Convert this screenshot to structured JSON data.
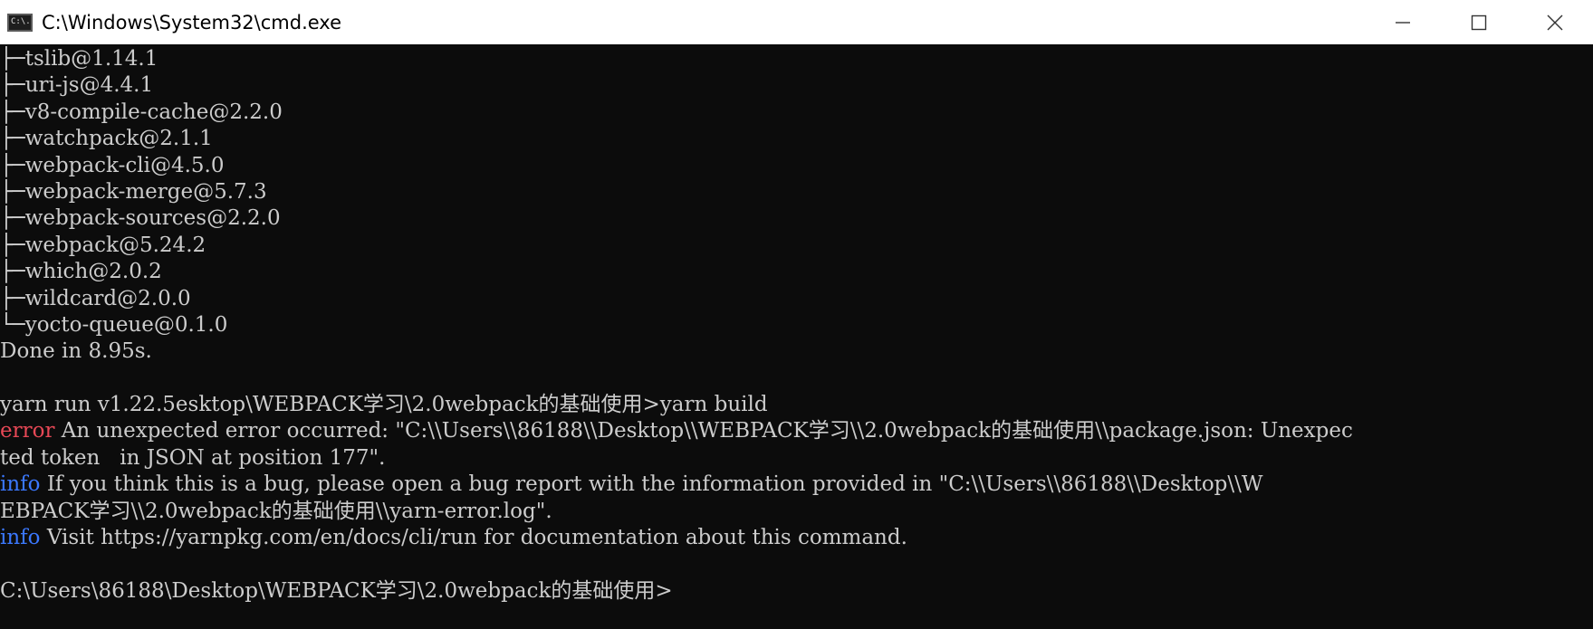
{
  "window": {
    "title": "C:\\Windows\\System32\\cmd.exe",
    "icon_text": "C:\\."
  },
  "colors": {
    "terminal_bg": "#0c0c0c",
    "text": "#cccccc",
    "error": "#e74856",
    "info": "#3b78ff"
  },
  "tree_lines": [
    {
      "prefix": "├─",
      "text": "tslib@1.14.1"
    },
    {
      "prefix": "├─",
      "text": "uri-js@4.4.1"
    },
    {
      "prefix": "├─",
      "text": "v8-compile-cache@2.2.0"
    },
    {
      "prefix": "├─",
      "text": "watchpack@2.1.1"
    },
    {
      "prefix": "├─",
      "text": "webpack-cli@4.5.0"
    },
    {
      "prefix": "├─",
      "text": "webpack-merge@5.7.3"
    },
    {
      "prefix": "├─",
      "text": "webpack-sources@2.2.0"
    },
    {
      "prefix": "├─",
      "text": "webpack@5.24.2"
    },
    {
      "prefix": "├─",
      "text": "which@2.0.2"
    },
    {
      "prefix": "├─",
      "text": "wildcard@2.0.0"
    },
    {
      "prefix": "└─",
      "text": "yocto-queue@0.1.0"
    }
  ],
  "done_line": "Done in 8.95s.",
  "run_line": "yarn run v1.22.5esktop\\WEBPACK学习\\2.0webpack的基础使用>yarn build",
  "error_line": {
    "tag": "error",
    "text": " An unexpected error occurred: \"C:\\\\Users\\\\86188\\\\Desktop\\\\WEBPACK学习\\\\2.0webpack的基础使用\\\\package.json: Unexpec"
  },
  "error_wrap": "ted token   in JSON at position 177\".",
  "info_line_1": {
    "tag": "info",
    "text": " If you think this is a bug, please open a bug report with the information provided in \"C:\\\\Users\\\\86188\\\\Desktop\\\\W"
  },
  "info_wrap": "EBPACK学习\\\\2.0webpack的基础使用\\\\yarn-error.log\".",
  "info_line_2": {
    "tag": "info",
    "text": " Visit https://yarnpkg.com/en/docs/cli/run for documentation about this command."
  },
  "prompt_line": "C:\\Users\\86188\\Desktop\\WEBPACK学习\\2.0webpack的基础使用>"
}
